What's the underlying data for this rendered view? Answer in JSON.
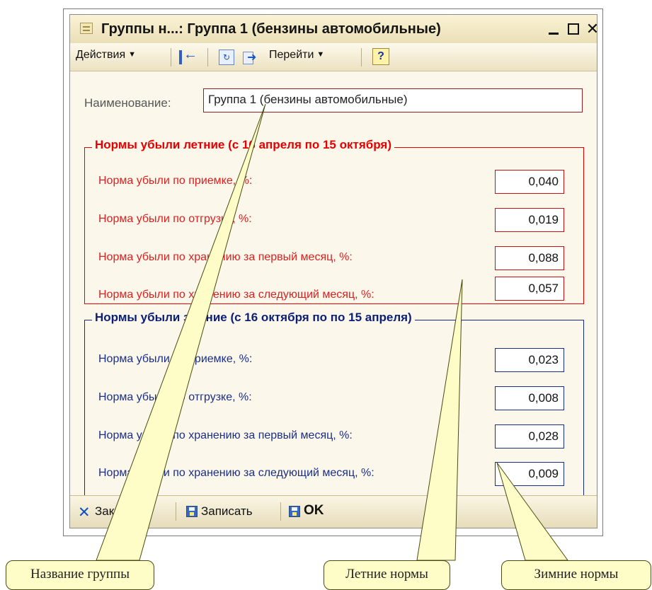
{
  "window": {
    "title": "Группы н...: Группа 1 (бензины автомобильные)",
    "close_glyph": "✕"
  },
  "toolbar": {
    "actions_label": "Действия",
    "goto_label": "Перейти",
    "help_label": "?"
  },
  "form": {
    "name_label": "Наименование:",
    "name_value": "Группа 1 (бензины автомобильные)"
  },
  "summer": {
    "title": "Нормы убыли летние (с 16 апреля по 15 октября)",
    "rows": [
      {
        "label": "Норма убыли по приемке, %:",
        "value": "0,040"
      },
      {
        "label": "Норма убыли по отгрузке, %:",
        "value": "0,019"
      },
      {
        "label": "Норма убыли по хранению за первый месяц, %:",
        "value": "0,088"
      },
      {
        "label": "Норма убыли по хранению за следующий месяц, %:",
        "value": "0,057"
      }
    ]
  },
  "winter": {
    "title": "Нормы убыли зимние (с 16 октября по по 15 апреля)",
    "rows": [
      {
        "label": "Норма убыли по приемке, %:",
        "value": "0,023"
      },
      {
        "label": "Норма убыли по отгрузке, %:",
        "value": "0,008"
      },
      {
        "label": "Норма убыли по хранению за первый месяц, %:",
        "value": "0,028"
      },
      {
        "label": "Норма убыли по хранению за следующий месяц, %:",
        "value": "0,009"
      }
    ]
  },
  "bottom_bar": {
    "close_label": "Закрыть",
    "save_label": "Записать",
    "ok_label": "OK"
  },
  "callouts": {
    "name": "Название группы",
    "summer": "Летние нормы",
    "winter": "Зимние нормы"
  },
  "icons": {
    "window": "form-icon",
    "back": "arrow-left-icon",
    "refresh": "refresh-icon",
    "goto": "goto-icon",
    "help": "help-icon",
    "close": "close-icon",
    "save": "save-icon",
    "ok": "ok-icon"
  }
}
